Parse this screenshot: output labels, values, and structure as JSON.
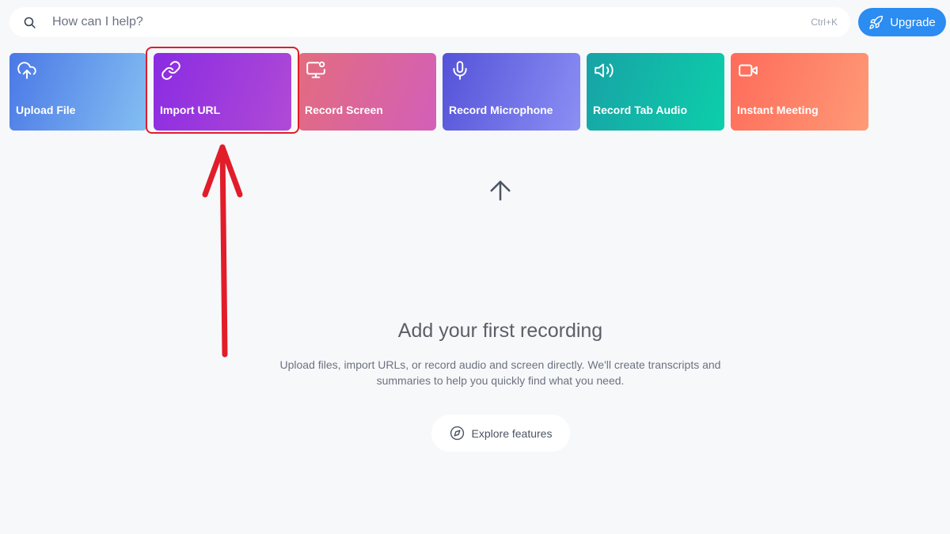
{
  "search": {
    "placeholder": "How can I help?",
    "value": "",
    "shortcut": "Ctrl+K"
  },
  "header": {
    "upgrade_label": "Upgrade"
  },
  "actions": [
    {
      "label": "Upload File",
      "icon": "cloud-upload-icon"
    },
    {
      "label": "Import URL",
      "icon": "link-icon"
    },
    {
      "label": "Record Screen",
      "icon": "monitor-record-icon"
    },
    {
      "label": "Record Microphone",
      "icon": "microphone-icon"
    },
    {
      "label": "Record Tab Audio",
      "icon": "speaker-icon"
    },
    {
      "label": "Instant Meeting",
      "icon": "video-camera-icon"
    }
  ],
  "empty_state": {
    "title": "Add your first recording",
    "description": "Upload files, import URLs, or record audio and screen directly. We'll create transcripts and summaries to help you quickly find what you need.",
    "explore_label": "Explore features"
  },
  "colors": {
    "accent": "#2b8cf2",
    "annotation": "#e11d2a",
    "background": "#f7f8fa"
  }
}
